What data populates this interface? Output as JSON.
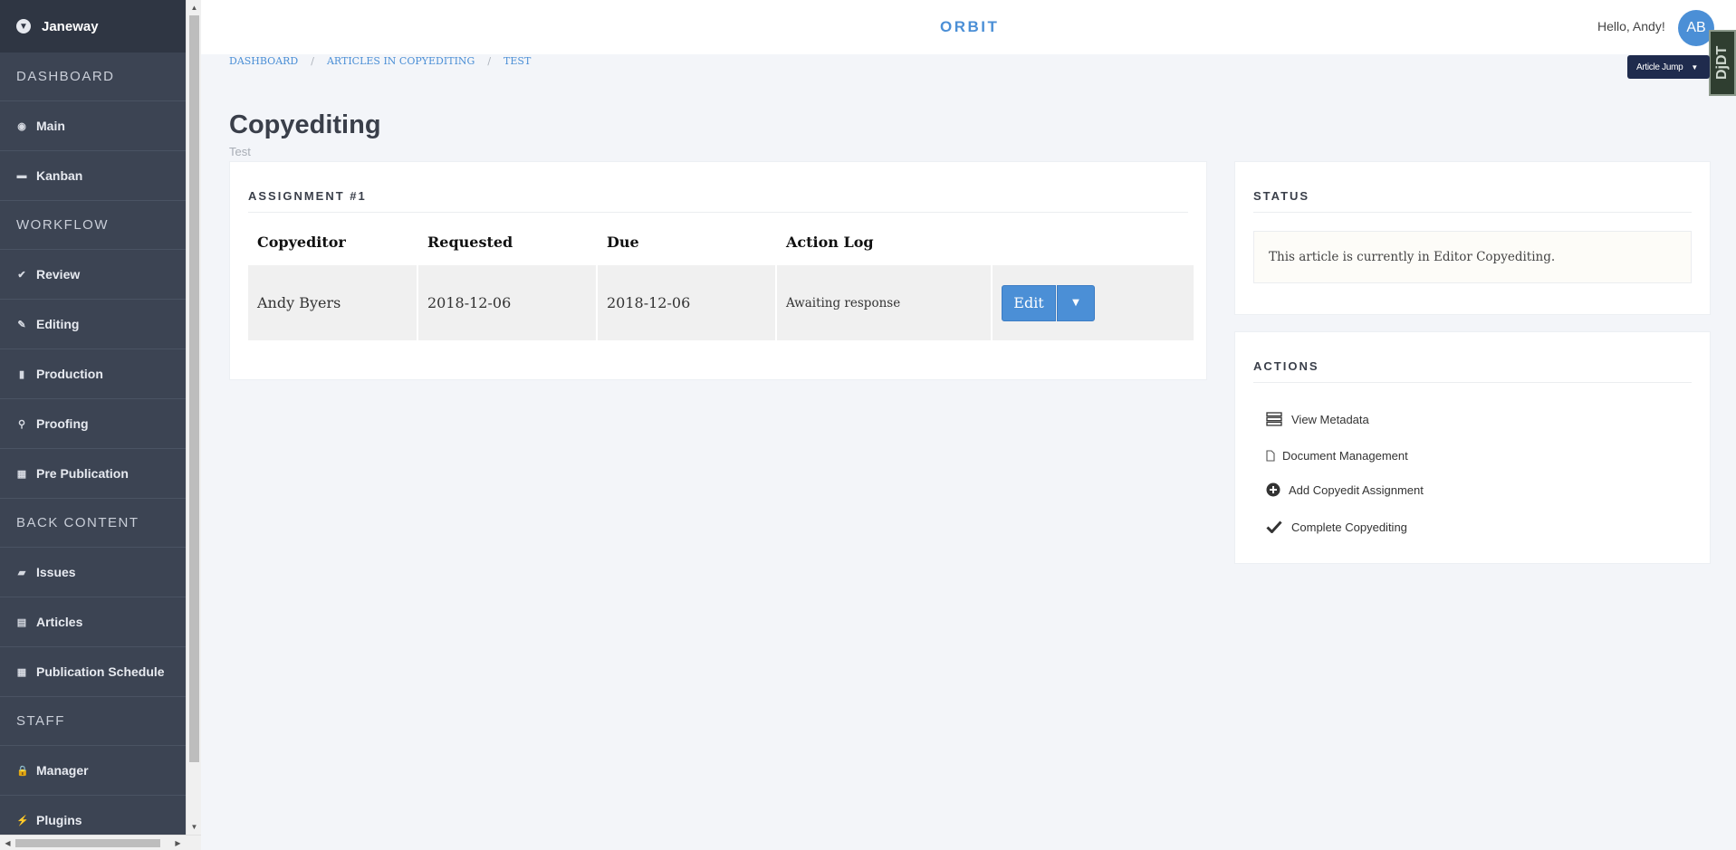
{
  "sidebar": {
    "brand": "Janeway",
    "items": [
      {
        "type": "section",
        "label": "DASHBOARD"
      },
      {
        "type": "item",
        "label": "Main",
        "icon": "dashboard-icon",
        "glyph": "◉"
      },
      {
        "type": "item",
        "label": "Kanban",
        "icon": "kanban-icon",
        "glyph": "▬"
      },
      {
        "type": "section",
        "label": "WORKFLOW"
      },
      {
        "type": "item",
        "label": "Review",
        "icon": "check-icon",
        "glyph": "✔"
      },
      {
        "type": "item",
        "label": "Editing",
        "icon": "pencil-icon",
        "glyph": "✎"
      },
      {
        "type": "item",
        "label": "Production",
        "icon": "bookmark-icon",
        "glyph": "▮"
      },
      {
        "type": "item",
        "label": "Proofing",
        "icon": "search-icon",
        "glyph": "⚲"
      },
      {
        "type": "item",
        "label": "Pre Publication",
        "icon": "archive-icon",
        "glyph": "▦"
      },
      {
        "type": "section",
        "label": "BACK CONTENT"
      },
      {
        "type": "item",
        "label": "Issues",
        "icon": "folder-open-icon",
        "glyph": "▰"
      },
      {
        "type": "item",
        "label": "Articles",
        "icon": "file-icon",
        "glyph": "▤"
      },
      {
        "type": "item",
        "label": "Publication Schedule",
        "icon": "calendar-icon",
        "glyph": "▦"
      },
      {
        "type": "section",
        "label": "STAFF"
      },
      {
        "type": "item",
        "label": "Manager",
        "icon": "lock-icon",
        "glyph": "🔒"
      },
      {
        "type": "item",
        "label": "Plugins",
        "icon": "plug-icon",
        "glyph": "⚡"
      }
    ]
  },
  "header": {
    "title": "ORBIT",
    "greeting": "Hello, Andy!",
    "avatar_initials": "AB",
    "debug_toolbar": "DjDT"
  },
  "breadcrumb": [
    "DASHBOARD",
    "ARTICLES IN COPYEDITING",
    "TEST"
  ],
  "article_jump": "Article Jump",
  "page": {
    "title": "Copyediting",
    "subtitle": "Test"
  },
  "assignment": {
    "title": "ASSIGNMENT #1",
    "columns": [
      "Copyeditor",
      "Requested",
      "Due",
      "Action Log"
    ],
    "row": {
      "copyeditor": "Andy Byers",
      "requested": "2018-12-06",
      "due": "2018-12-06",
      "action_log": "Awaiting response",
      "edit_label": "Edit"
    }
  },
  "status": {
    "title": "STATUS",
    "message": "This article is currently in Editor Copyediting."
  },
  "actions": {
    "title": "ACTIONS",
    "items": [
      {
        "label": "View Metadata",
        "icon": "server-icon"
      },
      {
        "label": "Document Management",
        "icon": "document-icon"
      },
      {
        "label": "Add Copyedit Assignment",
        "icon": "plus-circle-icon"
      },
      {
        "label": "Complete Copyediting",
        "icon": "check-icon"
      }
    ]
  },
  "colors": {
    "sidebar_bg": "#3c4453",
    "accent": "#4b8fd6",
    "article_jump_bg": "#1f2b4d"
  }
}
